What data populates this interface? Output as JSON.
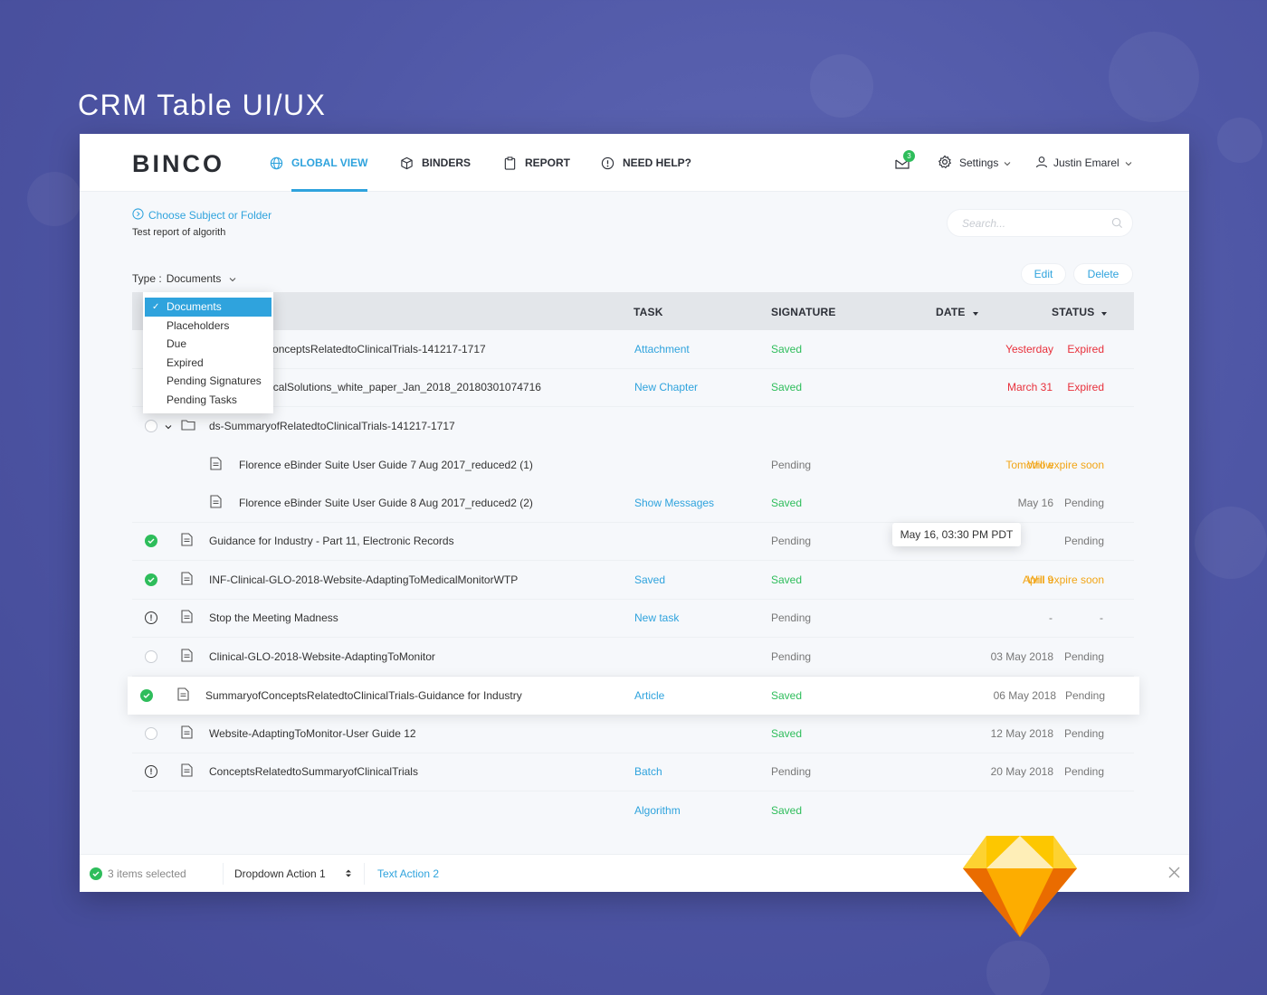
{
  "banner": {
    "title": "CRM Table UI/UX"
  },
  "nav": {
    "logo": "BINCO",
    "items": [
      {
        "label": "GLOBAL VIEW",
        "icon": "globe-icon",
        "active": true
      },
      {
        "label": "BINDERS",
        "icon": "cube-icon"
      },
      {
        "label": "REPORT",
        "icon": "clipboard-icon"
      },
      {
        "label": "NEED HELP?",
        "icon": "info-icon"
      }
    ],
    "mail_badge": "3",
    "settings_label": "Settings",
    "user_name": "Justin Emarel"
  },
  "toolbar": {
    "choose_label": "Choose Subject or Folder",
    "subtitle": "Test report of algorith",
    "search_placeholder": "Search...",
    "type_label": "Type :",
    "type_value": "Documents",
    "edit_label": "Edit",
    "delete_label": "Delete"
  },
  "type_menu": {
    "options": [
      "Documents",
      "Placeholders",
      "Due",
      "Expired",
      "Pending Signatures",
      "Pending Tasks"
    ],
    "selected": "Documents"
  },
  "table": {
    "headers": {
      "task": "TASK",
      "signature": "SIGNATURE",
      "date": "DATE",
      "status": "STATUS"
    },
    "rows": [
      {
        "name": "SummaryofConceptsRelatedtoClinicalTrials-141217-1717",
        "task": "Attachment",
        "signature": "Saved",
        "date": "Yesterday",
        "status": "Expired"
      },
      {
        "name": "DS-14_eClinicalSolutions_white_paper_Jan_2018_20180301074716",
        "task": "New Chapter",
        "signature": "Saved",
        "date": "March 31",
        "status": "Expired"
      },
      {
        "name": "ds-SummaryofRelatedtoClinicalTrials-141217-1717",
        "task": "",
        "signature": "",
        "date": "",
        "status": ""
      },
      {
        "name": "Florence eBinder Suite User Guide 7 Aug 2017_reduced2 (1)",
        "task": "",
        "signature": "Pending",
        "date": "Tomorrow",
        "status": "Will expire soon"
      },
      {
        "name": "Florence eBinder Suite User Guide 8 Aug 2017_reduced2 (2)",
        "task": "Show Messages",
        "signature": "Saved",
        "date": "May 16",
        "status": "Pending"
      },
      {
        "name": "Guidance for Industry - Part 11, Electronic Records",
        "task": "",
        "signature": "Pending",
        "date": "",
        "status": "Pending"
      },
      {
        "name": "INF-Clinical-GLO-2018-Website-AdaptingToMedicalMonitorWTP",
        "task": "Saved",
        "signature": "Saved",
        "date": "April 9",
        "status": "Will expire soon"
      },
      {
        "name": "Stop the Meeting Madness",
        "task": "New task",
        "signature": "Pending",
        "date": "-",
        "status": "-"
      },
      {
        "name": "Clinical-GLO-2018-Website-AdaptingToMonitor",
        "task": "",
        "signature": "Pending",
        "date": "03 May 2018",
        "status": "Pending"
      },
      {
        "name": "SummaryofConceptsRelatedtoClinicalTrials-Guidance for Industry",
        "task": "Article",
        "signature": "Saved",
        "date": "06 May 2018",
        "status": "Pending"
      },
      {
        "name": "Website-AdaptingToMonitor-User Guide 12",
        "task": "",
        "signature": "Saved",
        "date": "12 May 2018",
        "status": "Pending"
      },
      {
        "name": "ConceptsRelatedtoSummaryofClinicalTrials",
        "task": "Batch",
        "signature": "Pending",
        "date": "20 May 2018",
        "status": "Pending"
      },
      {
        "name": "",
        "task": "Algorithm",
        "signature": "Saved",
        "date": "",
        "status": ""
      }
    ],
    "tooltip": "May 16, 03:30 PM PDT"
  },
  "footer": {
    "selected_text": "3 items selected",
    "dropdown_action": "Dropdown Action 1",
    "text_action": "Text Action 2"
  },
  "colors": {
    "accent": "#2fa3dd",
    "success": "#2ebd5b",
    "danger": "#e8303b",
    "warning": "#f2a516"
  }
}
